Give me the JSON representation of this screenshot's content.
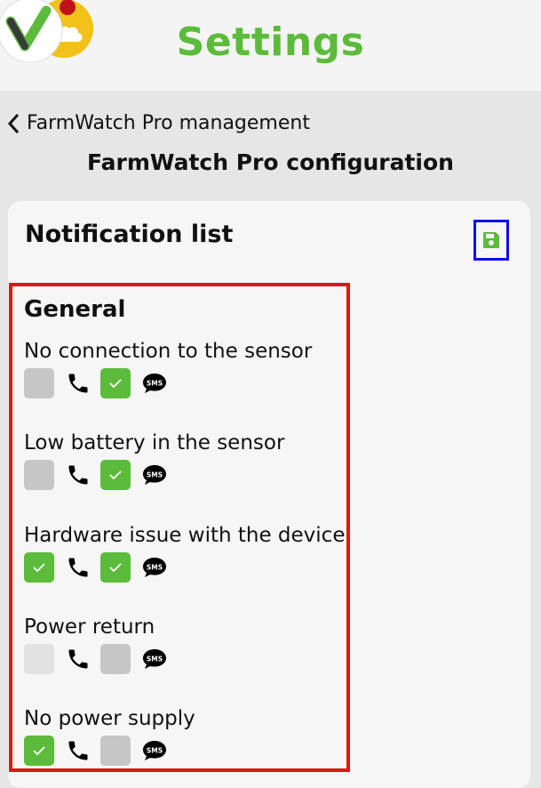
{
  "header": {
    "title": "Settings"
  },
  "nav": {
    "back_label": "FarmWatch Pro management"
  },
  "page": {
    "config_title": "FarmWatch Pro configuration"
  },
  "card": {
    "title": "Notification list",
    "section": "General",
    "items": [
      {
        "label": "No connection to the sensor",
        "call": "unchecked",
        "sms": "checked"
      },
      {
        "label": "Low battery in the sensor",
        "call": "unchecked",
        "sms": "checked"
      },
      {
        "label": "Hardware issue with the device",
        "call": "checked",
        "sms": "checked"
      },
      {
        "label": "Power return",
        "call": "disabled",
        "sms": "unchecked"
      },
      {
        "label": "No power supply",
        "call": "checked",
        "sms": "unchecked"
      }
    ],
    "sms_icon_text": "SMS"
  },
  "colors": {
    "accent": "#5cbb3b",
    "save_highlight": "#0b10e6",
    "section_highlight": "#e61414"
  },
  "icons": [
    "app-logo-icon",
    "chevron-left-icon",
    "save-icon",
    "phone-icon",
    "sms-icon",
    "check-icon"
  ]
}
